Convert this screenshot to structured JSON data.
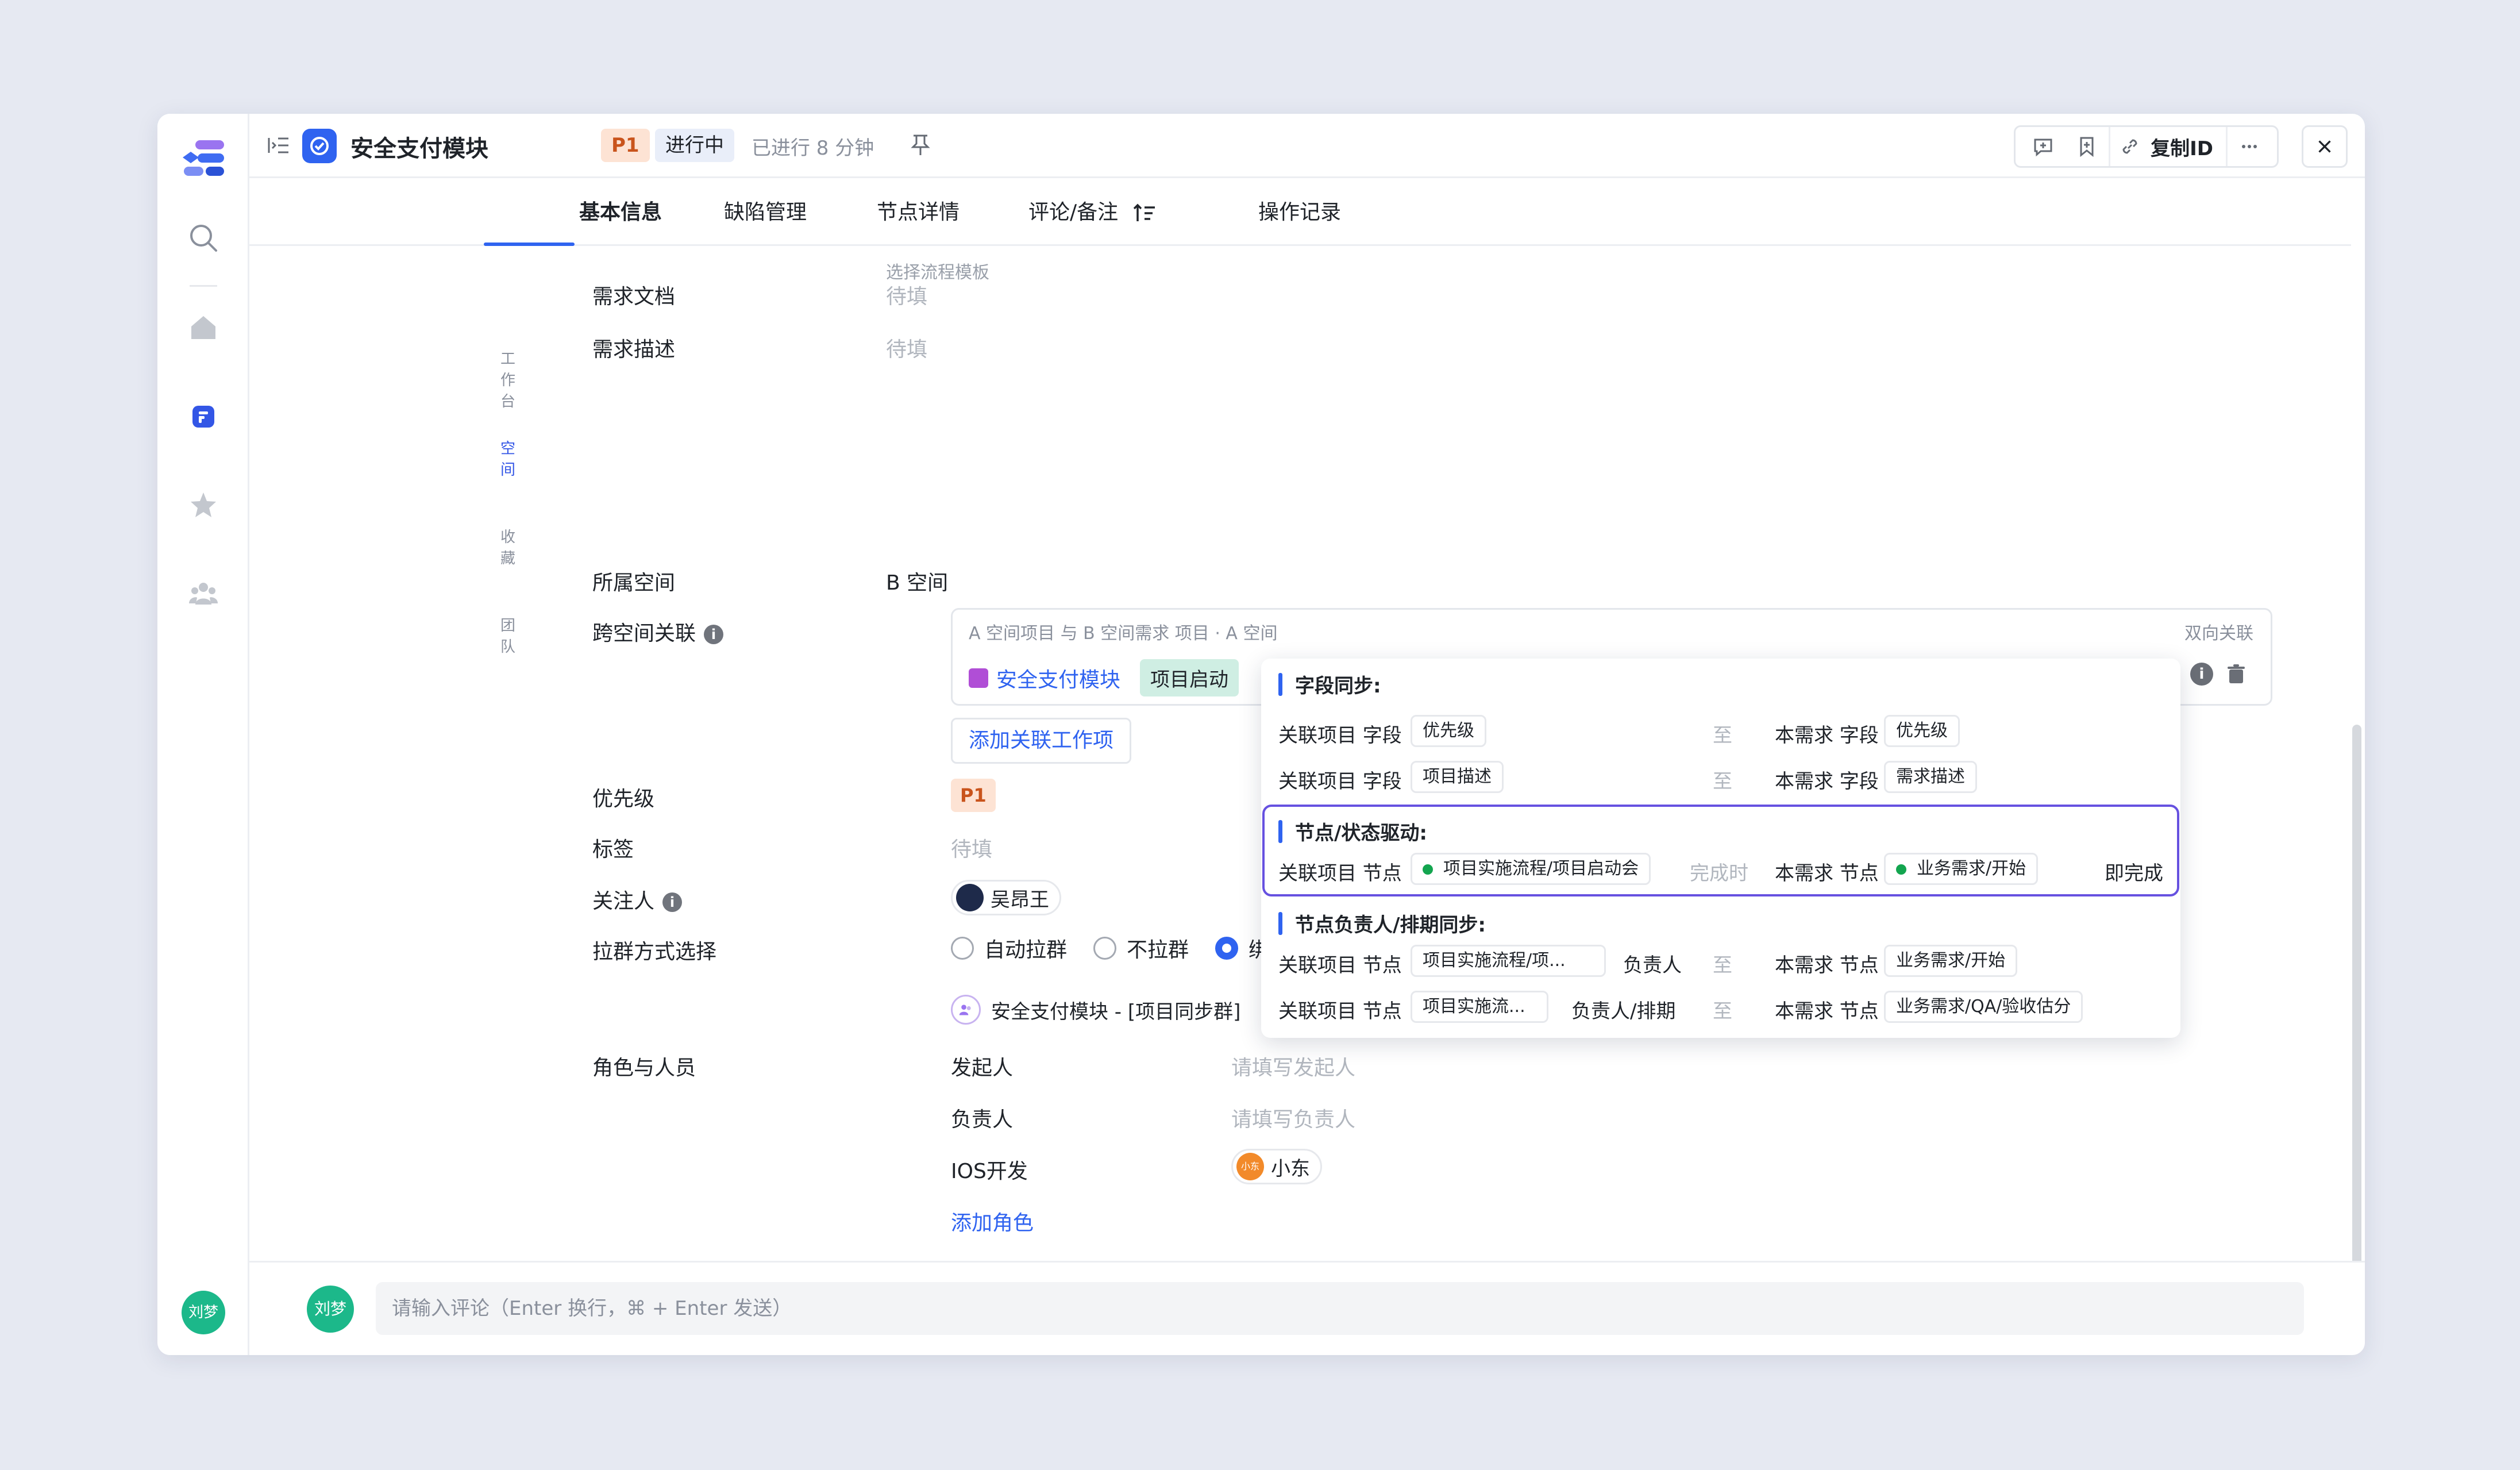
{
  "topbar": {
    "title": "安全支付模块",
    "priority": "P1",
    "status": "进行中",
    "elapsed": "已进行 8 分钟",
    "copy_id": "复制ID"
  },
  "sidebar": {
    "items": [
      {
        "label": "工作台",
        "icon": "home-icon"
      },
      {
        "label": "空间",
        "icon": "space-icon",
        "active": true
      },
      {
        "label": "收藏",
        "icon": "star-icon"
      },
      {
        "label": "团队",
        "icon": "team-icon"
      }
    ],
    "user_avatar": "刘梦"
  },
  "tabs": [
    {
      "label": "基本信息",
      "active": true
    },
    {
      "label": "缺陷管理"
    },
    {
      "label": "节点详情"
    },
    {
      "label": "评论/备注"
    },
    {
      "label": "操作记录"
    }
  ],
  "form": {
    "template_hint": "选择流程模板",
    "req_doc_label": "需求文档",
    "req_doc_value": "待填",
    "req_desc_label": "需求描述",
    "req_desc_value": "待填",
    "space_label": "所属空间",
    "space_value": "B 空间",
    "cross_label": "跨空间关联",
    "cross_header": "A 空间项目 与 B 空间需求  项目 · A 空间",
    "cross_bidirectional": "双向关联",
    "cross_item_name": "安全支付模块",
    "cross_item_tag": "项目启动",
    "add_related": "添加关联工作项",
    "priority_label": "优先级",
    "priority_value": "P1",
    "tags_label": "标签",
    "tags_value": "待填",
    "watcher_label": "关注人",
    "watcher_name": "吴昂王",
    "group_label": "拉群方式选择",
    "group_options": [
      "自动拉群",
      "不拉群",
      "绑定"
    ],
    "group_option_visible_3": "绑定",
    "group_name": "安全支付模块 - [项目同步群]",
    "roles_label": "角色与人员",
    "roles": [
      {
        "name": "发起人",
        "placeholder": "请填写发起人"
      },
      {
        "name": "负责人",
        "placeholder": "请填写负责人"
      },
      {
        "name": "IOS开发",
        "person": "小东",
        "avatar_text": "小东"
      }
    ],
    "add_role": "添加角色"
  },
  "popup": {
    "field_sync_title": "字段同步:",
    "field_rows": [
      {
        "left_label": "关联项目 字段",
        "left_chip": "优先级",
        "to": "至",
        "right_label": "本需求 字段",
        "right_chip": "优先级"
      },
      {
        "left_label": "关联项目 字段",
        "left_chip": "项目描述",
        "to": "至",
        "right_label": "本需求 字段",
        "right_chip": "需求描述"
      }
    ],
    "node_drive_title": "节点/状态驱动:",
    "node_drive_row": {
      "left_label": "关联项目 节点",
      "left_chip": "项目实施流程/项目启动会",
      "when": "完成时",
      "right_label": "本需求 节点",
      "right_chip": "业务需求/开始",
      "result": "即完成"
    },
    "owner_sync_title": "节点负责人/排期同步:",
    "owner_rows": [
      {
        "left_label": "关联项目 节点",
        "left_chip": "项目实施流程/项...",
        "field": "负责人",
        "to": "至",
        "right_label": "本需求 节点",
        "right_chip": "业务需求/开始"
      },
      {
        "left_label": "关联项目 节点",
        "left_chip": "项目实施流...",
        "field": "负责人/排期",
        "to": "至",
        "right_label": "本需求 节点",
        "right_chip": "业务需求/QA/验收估分"
      }
    ]
  },
  "footer": {
    "avatar": "刘梦",
    "comment_placeholder": "请输入评论（Enter 换行，⌘ + Enter 发送）"
  },
  "colors": {
    "accent": "#2f63f0",
    "priority_bg": "#fde3d4",
    "priority_fg": "#c9541c",
    "highlight_border": "#6651e0",
    "avatar_green": "#1cb88a"
  }
}
